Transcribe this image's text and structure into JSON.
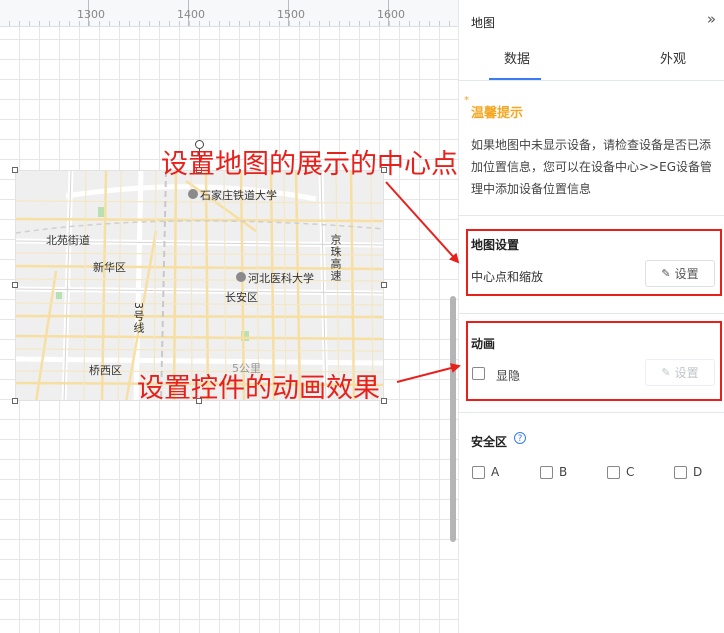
{
  "ruler": {
    "labels": [
      "1300",
      "1400",
      "1500",
      "1600"
    ]
  },
  "map": {
    "labels": {
      "railway_university": "石家庄铁道大学",
      "beiyuan": "北苑街道",
      "xinhua": "新华区",
      "hebei_medical": "河北医科大学",
      "changan": "长安区",
      "line3": "3号线",
      "jingzhu": "京珠高速",
      "qiaoxi": "桥西区",
      "scale": "5公里"
    }
  },
  "annotations": {
    "center_note": "设置地图的展示的中心点",
    "animation_note": "设置控件的动画效果"
  },
  "panel": {
    "title": "地图",
    "collapse_icon": "double-chevron-right-icon",
    "tabs": [
      {
        "label": "数据",
        "active": true
      },
      {
        "label": "外观",
        "active": false
      }
    ],
    "tips": {
      "star": "*",
      "title": "温馨提示",
      "body": "如果地图中未显示设备，请检查设备是否已添加位置信息，您可以在设备中心>>EG设备管理中添加设备位置信息"
    },
    "map_settings": {
      "title": "地图设置",
      "row_label": "中心点和缩放",
      "button_label": "设置"
    },
    "animation": {
      "title": "动画",
      "checkbox_label": "显隐",
      "checkbox_checked": false,
      "button_label": "设置"
    },
    "safe_zone": {
      "title": "安全区",
      "help_icon": "?",
      "options": [
        "A",
        "B",
        "C",
        "D"
      ]
    }
  },
  "colors": {
    "accent": "#3a7cf6",
    "annotation": "#e8201c",
    "tips": "#f5a623"
  }
}
